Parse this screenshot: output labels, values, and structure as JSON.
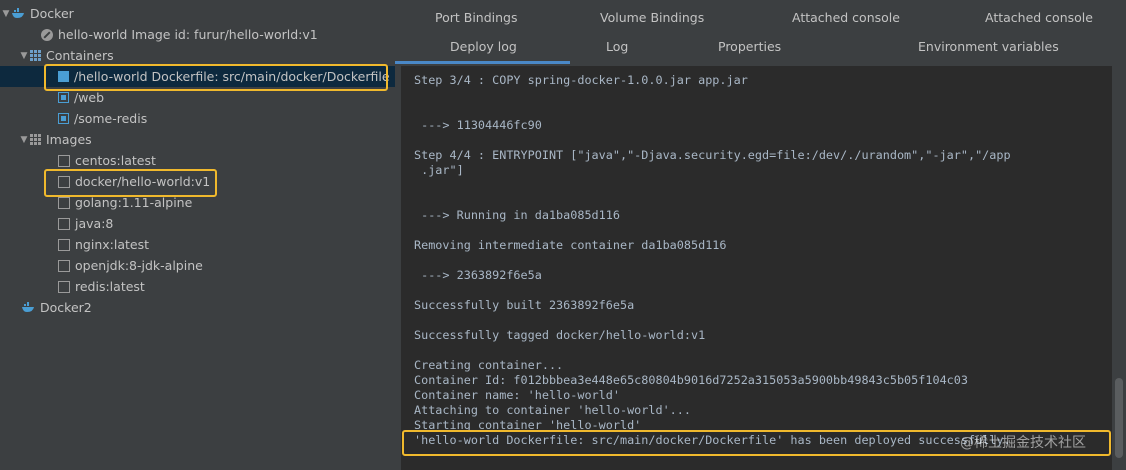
{
  "tree": {
    "docker": "Docker",
    "hello_world_image": "hello-world Image id: furur/hello-world:v1",
    "containers": "Containers",
    "container_items": [
      "/hello-world Dockerfile: src/main/docker/Dockerfile",
      "/web",
      "/some-redis"
    ],
    "images": "Images",
    "image_items": [
      "centos:latest",
      "docker/hello-world:v1",
      "golang:1.11-alpine",
      "java:8",
      "nginx:latest",
      "openjdk:8-jdk-alpine",
      "redis:latest"
    ],
    "docker2": "Docker2"
  },
  "tabs": {
    "row1": [
      "Port Bindings",
      "Volume Bindings",
      "Attached console",
      "Attached console"
    ],
    "row2": [
      "Deploy log",
      "Log",
      "Properties",
      "Environment variables"
    ]
  },
  "console_lines": [
    "Step 3/4 : COPY spring-docker-1.0.0.jar app.jar",
    " ---> 11304446fc90",
    "Step 4/4 : ENTRYPOINT [\"java\",\"-Djava.security.egd=file:/dev/./urandom\",\"-jar\",\"/app",
    " .jar\"]",
    " ---> Running in da1ba085d116",
    "Removing intermediate container da1ba085d116",
    " ---> 2363892f6e5a",
    "Successfully built 2363892f6e5a",
    "Successfully tagged docker/hello-world:v1",
    "Creating container...",
    "Container Id: f012bbbea3e448e65c80804b9016d7252a315053a5900bb49843c5b05f104c03",
    "Container name: 'hello-world'",
    "Attaching to container 'hello-world'...",
    "Starting container 'hello-world'",
    "'hello-world Dockerfile: src/main/docker/Dockerfile' has been deployed successfully."
  ],
  "watermark": "@稀土掘金技术社区",
  "colors": {
    "highlight": "#f0b92d",
    "selection": "#0d293e",
    "accent": "#4a88c7"
  }
}
